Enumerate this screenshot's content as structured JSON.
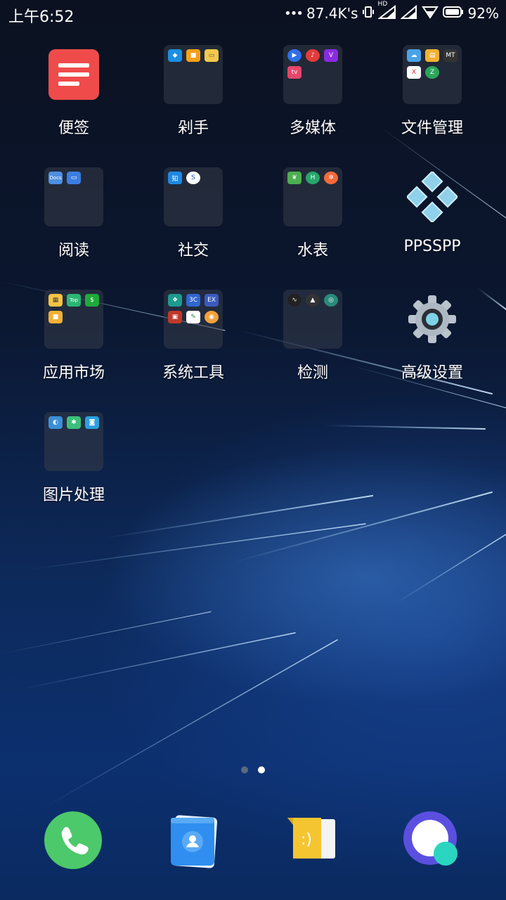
{
  "status": {
    "time": "上午6:52",
    "speed": "87.4K's",
    "battery": "92%",
    "hd": "HD"
  },
  "apps": [
    {
      "label": "便签",
      "type": "app",
      "icon": "notes-icon"
    },
    {
      "label": "剁手",
      "type": "folder"
    },
    {
      "label": "多媒体",
      "type": "folder"
    },
    {
      "label": "文件管理",
      "type": "folder"
    },
    {
      "label": "阅读",
      "type": "folder"
    },
    {
      "label": "社交",
      "type": "folder"
    },
    {
      "label": "水表",
      "type": "folder"
    },
    {
      "label": "PPSSPP",
      "type": "app",
      "icon": "ppsspp-icon"
    },
    {
      "label": "应用市场",
      "type": "folder"
    },
    {
      "label": "系统工具",
      "type": "folder"
    },
    {
      "label": "检测",
      "type": "folder"
    },
    {
      "label": "高级设置",
      "type": "app",
      "icon": "settings-gear-icon"
    },
    {
      "label": "图片处理",
      "type": "folder"
    }
  ],
  "folder_minis": {
    "shopping": [
      {
        "c": "#1a8fe3",
        "t": "◆"
      },
      {
        "c": "#f4a019",
        "t": "■"
      },
      {
        "c": "#f2c94c",
        "t": "▭"
      }
    ],
    "media": [
      {
        "c": "#2f6fe8",
        "t": "▶"
      },
      {
        "c": "#e43b3b",
        "t": "♪"
      },
      {
        "c": "#8a2be2",
        "t": "V"
      },
      {
        "c": "#e6456a",
        "t": "tv"
      }
    ],
    "files": [
      {
        "c": "#4aa3e8",
        "t": "☁"
      },
      {
        "c": "#f2b134",
        "t": "▤"
      },
      {
        "c": "#333",
        "t": "MT"
      },
      {
        "c": "#fff",
        "t": "X"
      },
      {
        "c": "#2aa65a",
        "t": "Z"
      }
    ],
    "reading": [
      {
        "c": "#4d8fe0",
        "t": "Docs"
      },
      {
        "c": "#3b7de0",
        "t": "▭"
      }
    ],
    "social": [
      {
        "c": "#1e88e5",
        "t": "知"
      },
      {
        "c": "#ffffff",
        "t": "S"
      }
    ],
    "meter": [
      {
        "c": "#4caf50",
        "t": "❦"
      },
      {
        "c": "#26a66a",
        "t": "H"
      },
      {
        "c": "#f26a3b",
        "t": "✲"
      }
    ],
    "market": [
      {
        "c": "#f6c343",
        "t": "▦"
      },
      {
        "c": "#2bb673",
        "t": "Top"
      },
      {
        "c": "#1faa3a",
        "t": "$"
      },
      {
        "c": "#f2b134",
        "t": "■"
      }
    ],
    "tools": [
      {
        "c": "#1c9a8e",
        "t": "❖"
      },
      {
        "c": "#2f66d0",
        "t": "3C"
      },
      {
        "c": "#3a5bbf",
        "t": "EX"
      },
      {
        "c": "#c0392b",
        "t": "▣"
      },
      {
        "c": "#ffffff",
        "t": "✎"
      },
      {
        "c": "#f2a23b",
        "t": "◉"
      }
    ],
    "detect": [
      {
        "c": "#222",
        "t": "∿"
      },
      {
        "c": "#333",
        "t": "▲"
      },
      {
        "c": "#2a8a7a",
        "t": "◎"
      }
    ],
    "photo": [
      {
        "c": "#3a8fd6",
        "t": "◐"
      },
      {
        "c": "#3cbf7a",
        "t": "✱"
      },
      {
        "c": "#2aa0e0",
        "t": "◙"
      }
    ]
  },
  "dock": [
    {
      "name": "phone",
      "icon": "phone-icon"
    },
    {
      "name": "contacts",
      "icon": "contacts-icon"
    },
    {
      "name": "messages",
      "icon": "messages-icon",
      "text": ":)"
    },
    {
      "name": "browser",
      "icon": "browser-icon"
    }
  ],
  "page_indicator": {
    "total": 2,
    "active": 2
  }
}
